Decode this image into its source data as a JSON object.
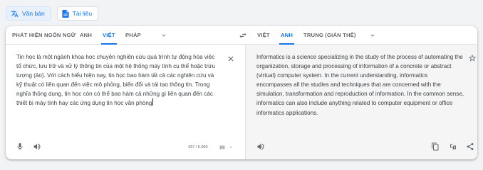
{
  "mode_tabs": {
    "text_label": "Văn bản",
    "documents_label": "Tài liệu"
  },
  "source_langs": [
    "PHÁT HIỆN NGÔN NGỮ",
    "ANH",
    "VIỆT",
    "PHÁP"
  ],
  "target_langs": [
    "VIỆT",
    "ANH",
    "TRUNG (GIẢN THỂ)"
  ],
  "source_active": "VIỆT",
  "target_active": "ANH",
  "source_text": "Tin học là một ngành khoa học chuyên nghiên cứu quá trình tự động hóa việc tổ chức, lưu trữ và xử lý thông tin của một hệ thống máy tính cụ thể hoặc trừu tượng (ảo). Với cách hiểu hiện nay, tin học bao hàm tất cả các nghiên cứu và kỹ thuật có liên quan đến việc mô phỏng, biến đổi và tái tạo thông tin. Trong nghĩa thông dụng, tin học còn có thể bao hàm cả những gì liên quan đến các thiết bị máy tính hay các ứng dụng tin học văn phòng",
  "translated_text": "Informatics is a science specializing in the study of the process of automating the organization, storage and processing of information of a concrete or abstract (virtual) computer system. In the current understanding, informatics encompasses all the studies and techniques that are concerned with the simulation, transformation and reproduction of information. In the common sense, informatics can also include anything related to computer equipment or office informatics applications.",
  "char_count": "437 / 5.000",
  "colors": {
    "accent": "#1a73e8",
    "text": "#3c4043",
    "muted": "#5f6368",
    "pane": "#f5f5f5"
  },
  "icons": [
    "translate-icon",
    "document-icon",
    "chevron-down-icon",
    "swap-icon",
    "close-icon",
    "microphone-icon",
    "speaker-icon",
    "keyboard-icon",
    "star-icon",
    "copy-icon",
    "feedback-icon",
    "share-icon"
  ]
}
